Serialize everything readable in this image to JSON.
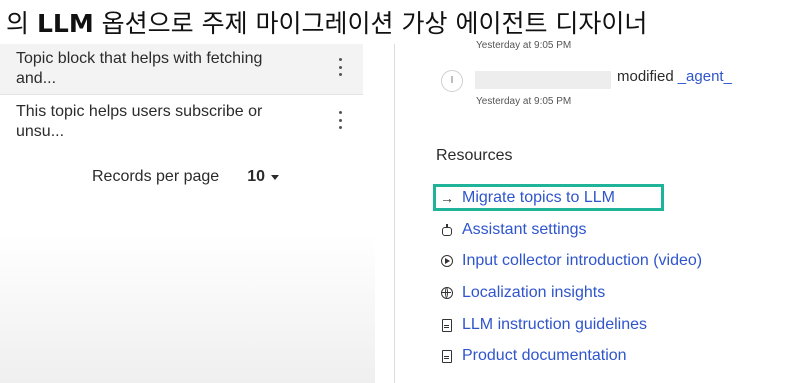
{
  "caption": {
    "prefix": "의 ",
    "strong": "LLM",
    "suffix": " 옵션으로 주제 마이그레이션 가상 에이전트 디자이너"
  },
  "topics": [
    {
      "description": "Topic block that helps with fetching and...",
      "menu_icon": "kebab-icon"
    },
    {
      "description": "This topic helps users subscribe or unsu...",
      "menu_icon": "kebab-icon"
    }
  ],
  "pagination": {
    "label": "Records per page",
    "value": "10"
  },
  "activity": {
    "top_time": "Yesterday at 9:05 PM",
    "avatar_initial": "I",
    "action": "modified",
    "link": "_agent_",
    "time": "Yesterday at 9:05 PM"
  },
  "resources": {
    "heading": "Resources",
    "highlight_color": "#1fb39a",
    "link_color": "#2f55cc",
    "items": [
      {
        "label": "Migrate topics to LLM",
        "icon": "arrow-right-icon"
      },
      {
        "label": "Assistant settings",
        "icon": "robot-icon"
      },
      {
        "label": "Input collector introduction (video)",
        "icon": "play-circle-icon"
      },
      {
        "label": "Localization insights",
        "icon": "globe-icon"
      },
      {
        "label": "LLM instruction guidelines",
        "icon": "document-icon"
      },
      {
        "label": "Product documentation",
        "icon": "document-icon"
      }
    ]
  }
}
